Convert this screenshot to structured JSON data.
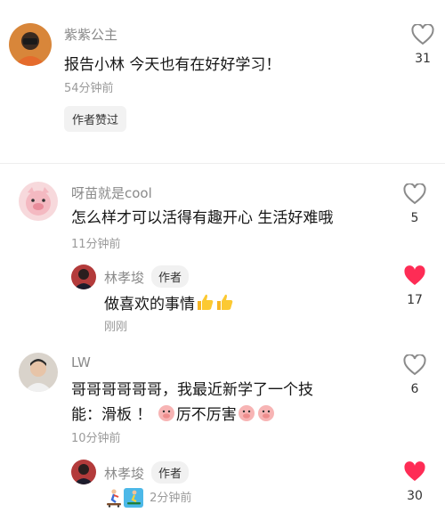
{
  "comments": [
    {
      "author": "紫紫公主",
      "text": "报告小林 今天也有在好好学习！",
      "time": "54分钟前",
      "likes": "31",
      "liked": false,
      "badge": "作者赞过"
    },
    {
      "author": "呀苗就是cool",
      "text": "怎么样才可以活得有趣开心 生活好难哦",
      "time": "11分钟前",
      "likes": "5",
      "liked": false,
      "reply": {
        "author": "林孝埈",
        "tag": "作者",
        "text": "做喜欢的事情",
        "time": "刚刚",
        "likes": "17",
        "liked": true
      }
    },
    {
      "author": "LW",
      "text_line1": "哥哥哥哥哥哥，我最近新学了一个技",
      "text_line2a": "能：滑板 ！",
      "text_line2b": "厉不厉害",
      "time": "10分钟前",
      "likes": "6",
      "liked": false,
      "reply": {
        "author": "林孝埈",
        "tag": "作者",
        "time": "2分钟前",
        "likes": "30",
        "liked": true
      }
    }
  ],
  "colors": {
    "liked": "#fe2c55",
    "unliked": "#8a8a8a"
  },
  "icons": [
    "heart-outline-icon",
    "heart-filled-icon",
    "thumbs-up-emoji",
    "pig-face-emoji",
    "skateboard-emoji"
  ]
}
